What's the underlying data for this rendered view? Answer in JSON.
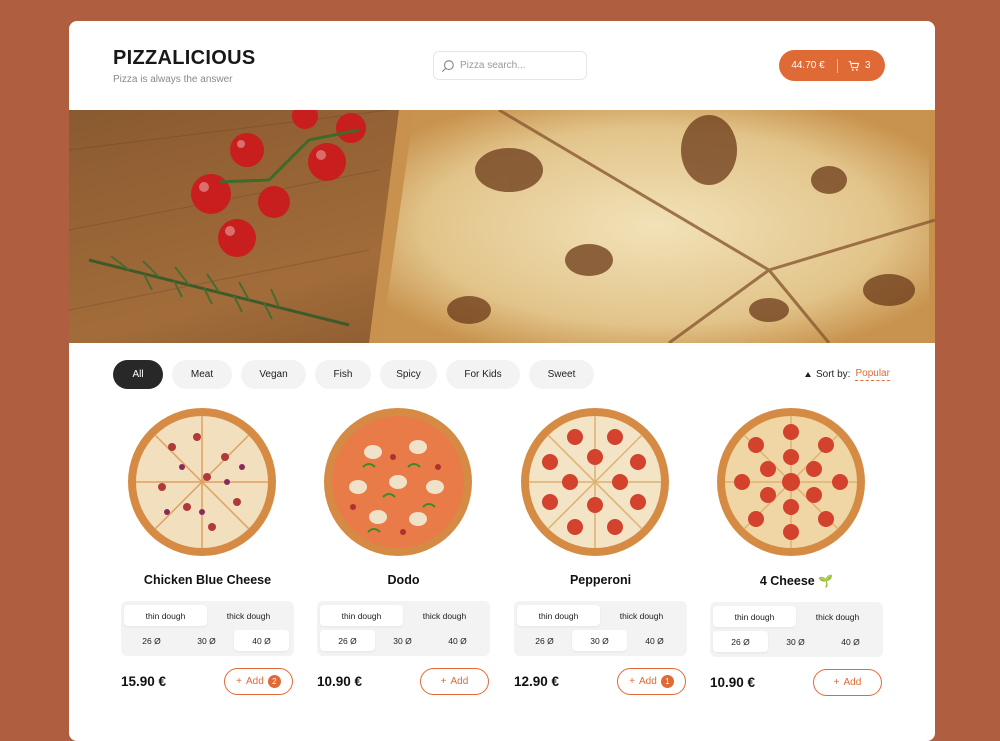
{
  "header": {
    "title": "PIZZALICIOUS",
    "subtitle": "Pizza is always the answer",
    "search_placeholder": "Pizza search...",
    "cart_total": "44.70 €",
    "cart_count": "3"
  },
  "filters": [
    "All",
    "Meat",
    "Vegan",
    "Fish",
    "Spicy",
    "For Kids",
    "Sweet"
  ],
  "sort": {
    "label": "Sort by:",
    "value": "Popular"
  },
  "products": [
    {
      "name": "Chicken Blue Cheese",
      "dough": [
        "thin dough",
        "thick dough"
      ],
      "sizes": [
        "26 Ø",
        "30 Ø",
        "40 Ø"
      ],
      "price": "15.90 €",
      "add": "Add",
      "qty": "2",
      "leaf": ""
    },
    {
      "name": "Dodo",
      "dough": [
        "thin dough",
        "thick dough"
      ],
      "sizes": [
        "26 Ø",
        "30 Ø",
        "40 Ø"
      ],
      "price": "10.90 €",
      "add": "Add",
      "qty": "",
      "leaf": ""
    },
    {
      "name": "Pepperoni",
      "dough": [
        "thin dough",
        "thick dough"
      ],
      "sizes": [
        "26 Ø",
        "30 Ø",
        "40 Ø"
      ],
      "price": "12.90 €",
      "add": "Add",
      "qty": "1",
      "leaf": ""
    },
    {
      "name": "4 Cheese",
      "dough": [
        "thin dough",
        "thick dough"
      ],
      "sizes": [
        "26 Ø",
        "30 Ø",
        "40 Ø"
      ],
      "price": "10.90 €",
      "add": "Add",
      "qty": "",
      "leaf": "🌱"
    }
  ],
  "colors": {
    "accent": "#E06A35",
    "background": "#B05E40",
    "chip_active": "#282828"
  }
}
